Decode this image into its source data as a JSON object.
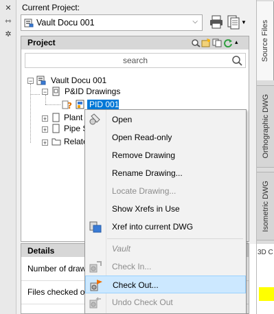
{
  "header": {
    "current_project_label": "Current Project:",
    "current_project_value": "Vault Docu 001"
  },
  "project_panel": {
    "title": "Project",
    "search_placeholder": "search"
  },
  "tree": {
    "root": "Vault Docu 001",
    "pid_folder": "P&ID Drawings",
    "pid_file": "PID 001",
    "plant3d": "Plant 3",
    "pipe": "Pipe S",
    "related": "Relate"
  },
  "details": {
    "title": "Details",
    "row1": "Number of draw",
    "row2": "Files checked ou"
  },
  "right_tabs": {
    "source": "Source Files",
    "ortho": "Orthographic DWG",
    "iso": "Isometric DWG"
  },
  "right_pane_text": "3D C",
  "context_menu": {
    "open": "Open",
    "open_readonly": "Open Read-only",
    "remove": "Remove Drawing",
    "rename": "Rename Drawing...",
    "locate": "Locate Drawing...",
    "show_xrefs": "Show Xrefs in Use",
    "xref_into": "Xref into current DWG",
    "vault_header": "Vault",
    "check_in": "Check In...",
    "check_out": "Check Out...",
    "undo_check_out": "Undo Check Out"
  },
  "colors": {
    "selection": "#0078d7",
    "menu_hover": "#cce8ff",
    "highlight_yellow": "#ffff00"
  }
}
